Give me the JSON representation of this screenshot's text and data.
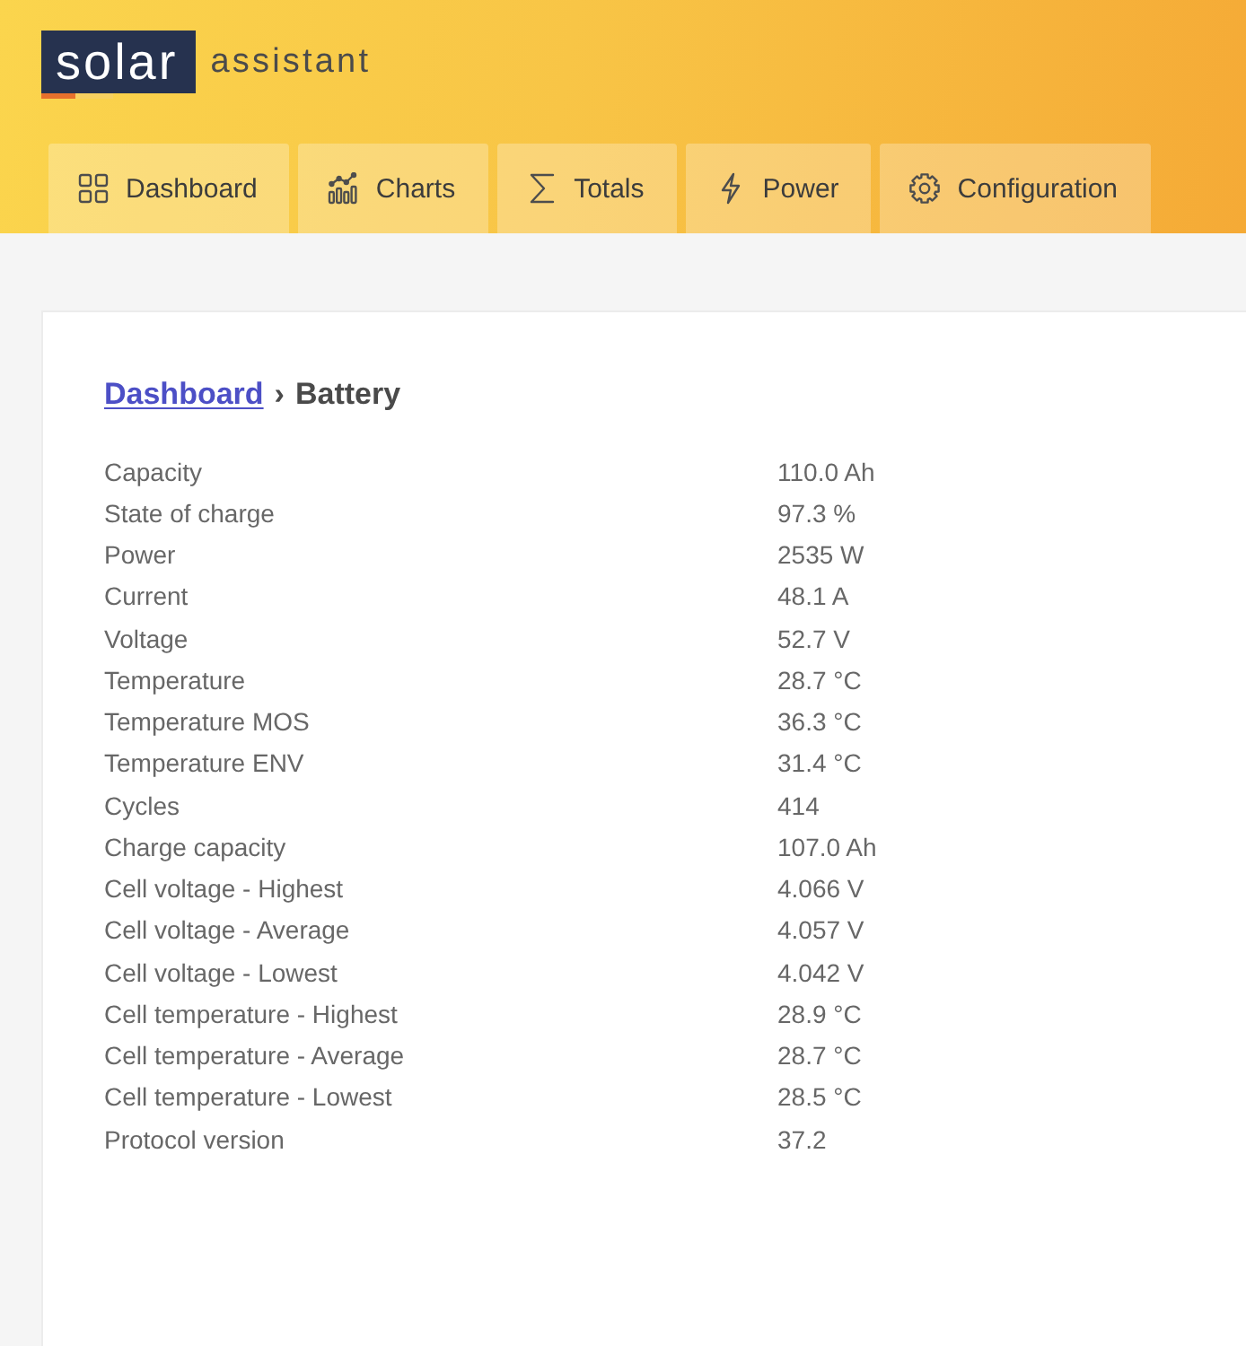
{
  "header": {
    "logo": {
      "mark": "solar",
      "text": "assistant"
    },
    "tabs": [
      {
        "label": "Dashboard",
        "kind": "dashboard"
      },
      {
        "label": "Charts",
        "kind": "charts"
      },
      {
        "label": "Totals",
        "kind": "totals"
      },
      {
        "label": "Power",
        "kind": "power"
      },
      {
        "label": "Configuration",
        "kind": "configuration"
      }
    ]
  },
  "battery": {
    "breadcrumb": {
      "link": "Dashboard",
      "separator": "›",
      "current": "Battery"
    },
    "properties": [
      {
        "label": "Capacity",
        "value": "110.0 Ah"
      },
      {
        "label": "State of charge",
        "value": "97.3 %"
      },
      {
        "label": "Power",
        "value": "2535 W"
      },
      {
        "label": "Current",
        "value": "48.1 A"
      },
      {
        "label": "Voltage",
        "value": "52.7 V"
      },
      {
        "label": "Temperature",
        "value": "28.7 °C"
      },
      {
        "label": "Temperature MOS",
        "value": "36.3 °C"
      },
      {
        "label": "Temperature ENV",
        "value": "31.4 °C"
      },
      {
        "label": "Cycles",
        "value": "414"
      },
      {
        "label": "Charge capacity",
        "value": "107.0 Ah"
      },
      {
        "label": "Cell voltage - Highest",
        "value": "4.066 V"
      },
      {
        "label": "Cell voltage - Average",
        "value": "4.057 V"
      },
      {
        "label": "Cell voltage - Lowest",
        "value": "4.042 V"
      },
      {
        "label": "Cell temperature - Highest",
        "value": "28.9 °C"
      },
      {
        "label": "Cell temperature - Average",
        "value": "28.7 °C"
      },
      {
        "label": "Cell temperature - Lowest",
        "value": "28.5 °C"
      },
      {
        "label": "Protocol version",
        "value": "37.2"
      }
    ]
  }
}
